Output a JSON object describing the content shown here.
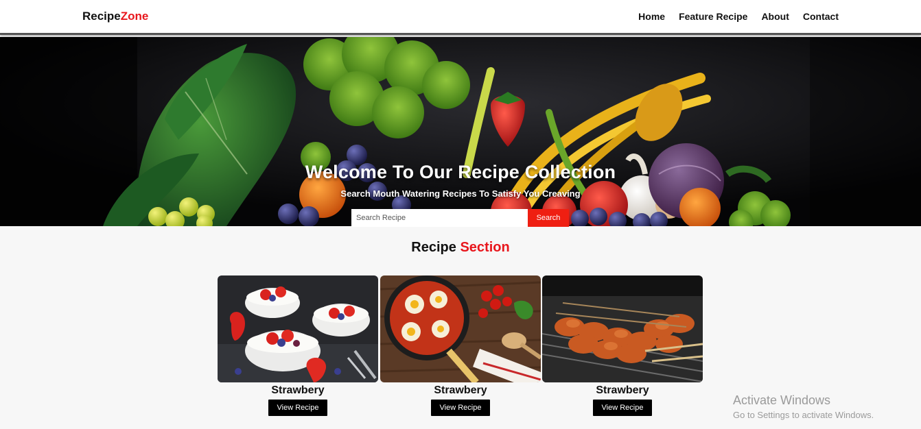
{
  "logo": {
    "part1": "Recipe",
    "part2": "Zone"
  },
  "nav": [
    {
      "label": "Home"
    },
    {
      "label": "Feature Recipe"
    },
    {
      "label": "About"
    },
    {
      "label": "Contact"
    }
  ],
  "hero": {
    "title": "Welcome To Our Recipe Collection",
    "subtitle": "Search Mouth Watering Recipes To Satisfy You Creaving"
  },
  "search": {
    "placeholder": "Search Recipe",
    "button": "Search"
  },
  "section": {
    "title_part1": "Recipe",
    "title_part2": "Section"
  },
  "cards": [
    {
      "name": "Strawbery",
      "button": "View Recipe"
    },
    {
      "name": "Strawbery",
      "button": "View Recipe"
    },
    {
      "name": "Strawbery",
      "button": "View Recipe"
    }
  ],
  "watermark": {
    "line1": "Activate Windows",
    "line2": "Go to Settings to activate Windows."
  },
  "colors": {
    "accent": "#e8161c",
    "search_button": "#ef1f12",
    "button_bg": "#000000"
  }
}
